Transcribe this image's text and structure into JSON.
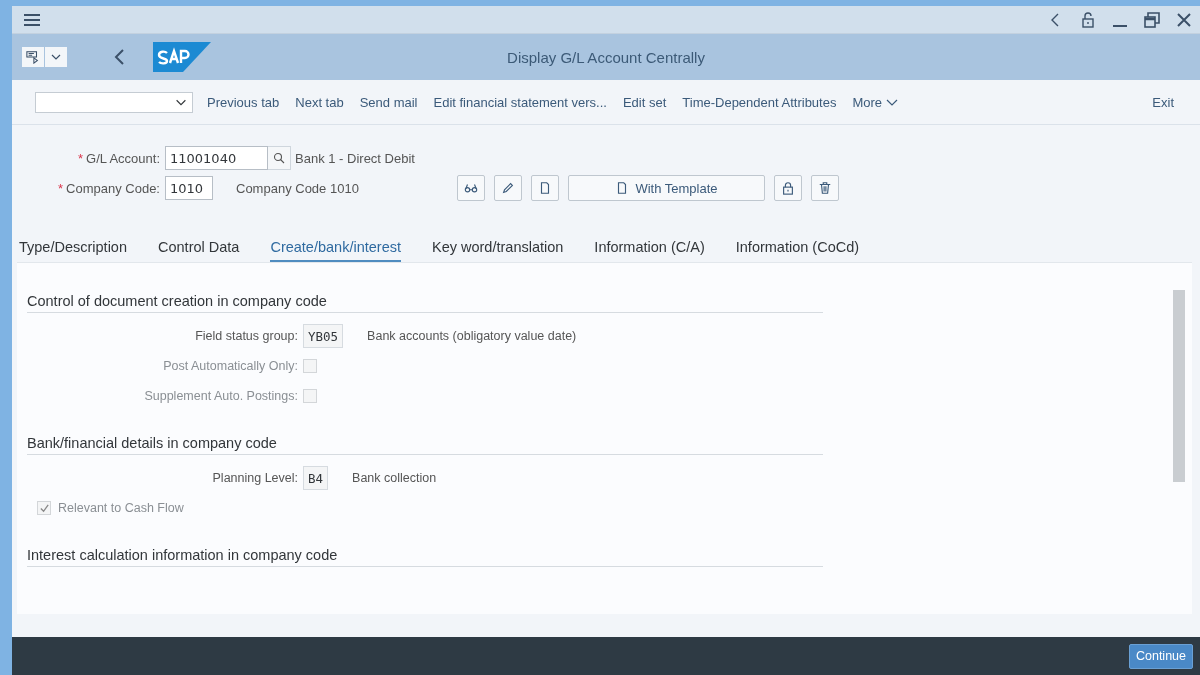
{
  "header": {
    "title": "Display G/L Account Centrally"
  },
  "toolbar": {
    "items": [
      "Previous tab",
      "Next tab",
      "Send mail",
      "Edit financial statement vers...",
      "Edit set",
      "Time-Dependent Attributes"
    ],
    "more": "More",
    "exit": "Exit"
  },
  "key_fields": [
    {
      "label": "G/L Account:",
      "required": true,
      "required_mark": "*",
      "value": "11001040",
      "search": true,
      "description": "Bank 1 - Direct Debit"
    },
    {
      "label": "Company Code:",
      "required": true,
      "required_mark": "*",
      "value": "1010",
      "description": "Company Code 1010"
    }
  ],
  "action_buttons": [
    {
      "kind": "glasses"
    },
    {
      "kind": "pencil"
    },
    {
      "kind": "page"
    },
    {
      "kind": "template",
      "label": "With Template"
    },
    {
      "kind": "lock"
    },
    {
      "kind": "trash"
    }
  ],
  "tabs": [
    {
      "label": "Type/Description",
      "selected": false
    },
    {
      "label": "Control Data",
      "selected": false
    },
    {
      "label": "Create/bank/interest",
      "selected": true
    },
    {
      "label": "Key word/translation",
      "selected": false
    },
    {
      "label": "Information (C/A)",
      "selected": false
    },
    {
      "label": "Information (CoCd)",
      "selected": false
    }
  ],
  "sections": [
    {
      "title": "Control of document creation in company code",
      "fields": [
        {
          "kind": "input",
          "label": "Field status group:",
          "value": "YB05",
          "description": "Bank accounts (obligatory value date)"
        },
        {
          "kind": "checkbox",
          "label": "Post Automatically Only:",
          "checked": false,
          "disabled": true
        },
        {
          "kind": "checkbox",
          "label": "Supplement Auto. Postings:",
          "checked": false,
          "disabled": true
        }
      ]
    },
    {
      "title": "Bank/financial details in company code",
      "fields": [
        {
          "kind": "input",
          "label": "Planning Level:",
          "value": "B4",
          "description": "Bank collection"
        },
        {
          "kind": "check_left",
          "label": "Relevant to Cash Flow",
          "checked": true,
          "disabled": true
        }
      ]
    },
    {
      "title": "Interest calculation information in company code"
    }
  ],
  "footer": {
    "button": "Continue"
  }
}
